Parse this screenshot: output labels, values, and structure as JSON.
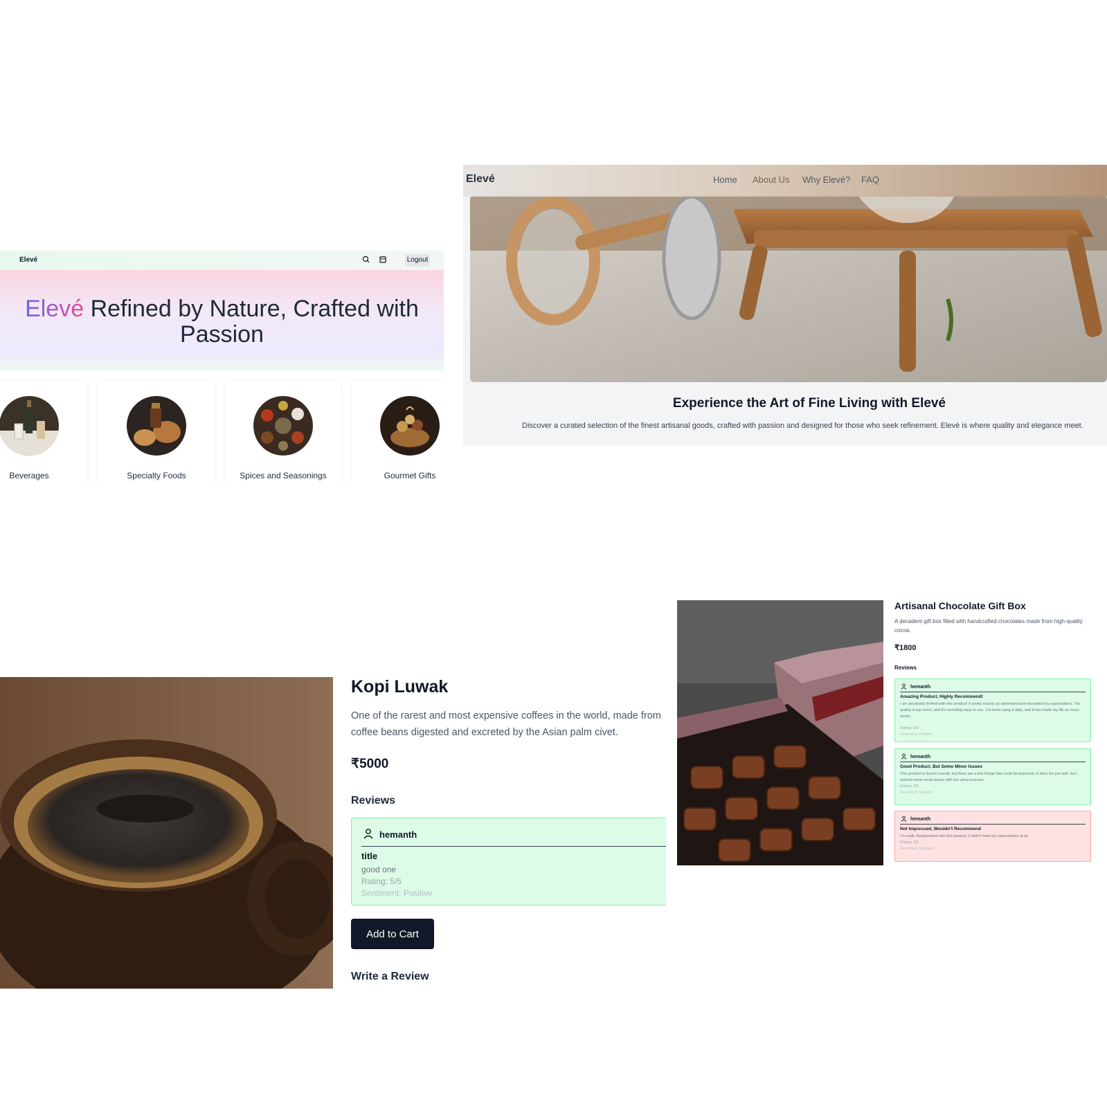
{
  "shop": {
    "brand": "Elevé",
    "logout_label": "Logout",
    "icons": [
      "search-icon",
      "cart-icon"
    ],
    "hero_brand": "Elevé",
    "hero_text": " Refined by Nature, Crafted with Passion",
    "categories": [
      {
        "label": "Beverages"
      },
      {
        "label": "Specialty Foods"
      },
      {
        "label": "Spices and Seasonings"
      },
      {
        "label": "Gourmet Gifts"
      }
    ]
  },
  "about": {
    "brand": "Elevé",
    "nav": [
      "Home",
      "About Us",
      "Why Elevé?",
      "FAQ"
    ],
    "heading": "Experience the Art of Fine Living with Elevé",
    "description": "Discover a curated selection of the finest artisanal goods, crafted with passion and designed for those who seek refinement. Elevé is where quality and elegance meet."
  },
  "kopi": {
    "title": "Kopi Luwak",
    "description": "One of the rarest and most expensive coffees in the world, made from coffee beans digested and excreted by the Asian palm civet.",
    "price": "₹5000",
    "reviews_heading": "Reviews",
    "review": {
      "user": "hemanth",
      "title": "title",
      "comment": "good one",
      "rating": "Rating: 5/5",
      "sentiment": "Sentiment: Positive"
    },
    "add_to_cart": "Add to Cart",
    "write_review": "Write a Review"
  },
  "chocolate": {
    "title": "Artisanal Chocolate Gift Box",
    "description": "A decadent gift box filled with handcrafted chocolates made from high-quality cocoa.",
    "price": "₹1800",
    "reviews_heading": "Reviews",
    "reviews": [
      {
        "user": "hemanth",
        "title": "Amazing Product, Highly Recommend!",
        "comment": "I am absolutely thrilled with this product! It works exactly as advertised and exceeded my expectations. The quality is top notch, and it's incredibly easy to use. I've been using it daily, and it has made my life so much easier.",
        "rating": "Rating: 5/5",
        "sentiment": "Sentiment: Positive",
        "tone": "positive"
      },
      {
        "user": "hemanth",
        "title": "Good Product, But Some Minor Issues",
        "comment": "This product is decent overall, but there are a few things that could be improved. It does the job well, but I noticed some small issues with the setup process.",
        "rating": "Rating: 2/5",
        "sentiment": "Sentiment: Positive",
        "tone": "positive"
      },
      {
        "user": "hemanth",
        "title": "Not Impressed, Wouldn't Recommend",
        "comment": "I'm really disappointed with this product. It didn't meet my expectations at all.",
        "rating": "Rating: 1/5",
        "sentiment": "Sentiment: Negative",
        "tone": "negative"
      }
    ]
  },
  "colors": {
    "accent_dark": "#111827",
    "review_positive_bg": "#dcfce7",
    "review_negative_bg": "#fee2e2",
    "hero_gradient_start": "#6366f1",
    "hero_gradient_end": "#ec4899"
  }
}
